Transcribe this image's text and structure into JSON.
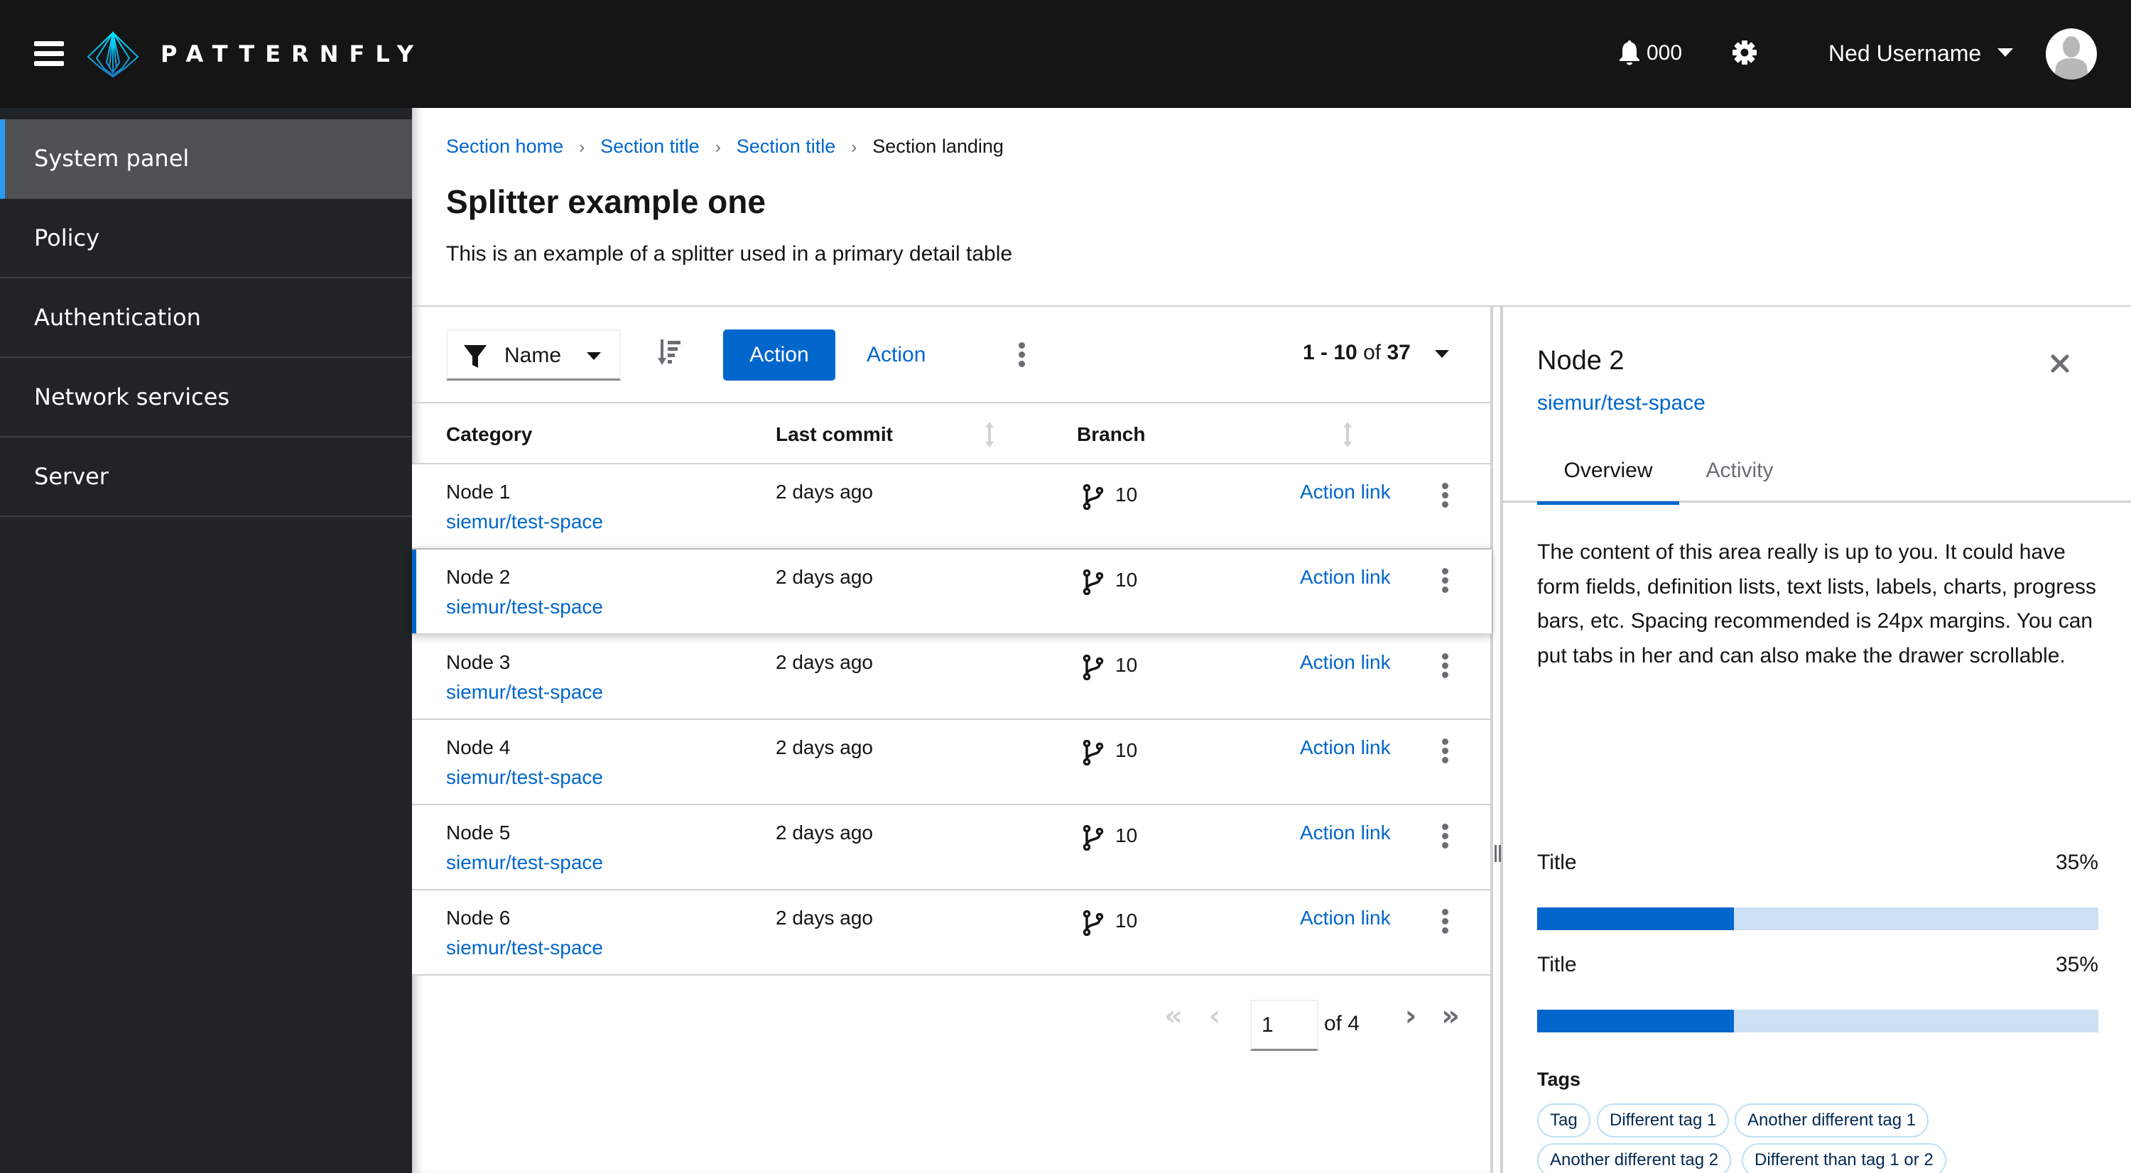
{
  "masthead": {
    "brand": "PATTERNFLY",
    "notification_count": "000",
    "user_name": "Ned Username",
    "icons": {
      "menu": "hamburger-icon",
      "logo": "patternfly-logo-icon",
      "notifications": "bell-icon",
      "settings": "gear-icon",
      "user_menu": "caret-down-icon",
      "avatar": "user-avatar-icon"
    }
  },
  "sidebar": {
    "items": [
      {
        "label": "System panel",
        "active": true
      },
      {
        "label": "Policy",
        "active": false
      },
      {
        "label": "Authentication",
        "active": false
      },
      {
        "label": "Network services",
        "active": false
      },
      {
        "label": "Server",
        "active": false
      }
    ]
  },
  "breadcrumb": {
    "items": [
      "Section home",
      "Section title",
      "Section title"
    ],
    "current": "Section landing",
    "separator_icon": "angle-right-icon"
  },
  "page": {
    "title": "Splitter example one",
    "description": "This is an example of a splitter used in a primary detail table"
  },
  "toolbar": {
    "filter_label": "Name",
    "filter_icon": "filter-icon",
    "sort_icon": "sort-amount-down-icon",
    "primary_action": "Action",
    "link_action": "Action",
    "overflow_icon": "kebab-icon",
    "pagination": {
      "range": "1 - 10",
      "of_label": "of",
      "total": "37"
    }
  },
  "table": {
    "columns": [
      {
        "label": "Category",
        "sortable": true
      },
      {
        "label": "Last commit",
        "sortable": true
      },
      {
        "label": "Branch",
        "sortable": false
      }
    ],
    "rows": [
      {
        "name": "Node 1",
        "repo": "siemur/test-space",
        "commit": "2 days ago",
        "branches": "10",
        "action": "Action link",
        "selected": false
      },
      {
        "name": "Node 2",
        "repo": "siemur/test-space",
        "commit": "2 days ago",
        "branches": "10",
        "action": "Action link",
        "selected": true
      },
      {
        "name": "Node 3",
        "repo": "siemur/test-space",
        "commit": "2 days ago",
        "branches": "10",
        "action": "Action link",
        "selected": false
      },
      {
        "name": "Node 4",
        "repo": "siemur/test-space",
        "commit": "2 days ago",
        "branches": "10",
        "action": "Action link",
        "selected": false
      },
      {
        "name": "Node 5",
        "repo": "siemur/test-space",
        "commit": "2 days ago",
        "branches": "10",
        "action": "Action link",
        "selected": false
      },
      {
        "name": "Node 6",
        "repo": "siemur/test-space",
        "commit": "2 days ago",
        "branches": "10",
        "action": "Action link",
        "selected": false
      }
    ]
  },
  "pagination": {
    "current_page": "1",
    "of_label": "of 4",
    "first_enabled": false,
    "prev_enabled": false,
    "next_enabled": true,
    "last_enabled": true,
    "icons": {
      "first": "«",
      "prev": "‹",
      "next": "›",
      "last": "»"
    }
  },
  "drawer": {
    "title": "Node 2",
    "link": "siemur/test-space",
    "close_icon": "times-icon",
    "tabs": [
      {
        "label": "Overview",
        "active": true
      },
      {
        "label": "Activity",
        "active": false
      }
    ],
    "body": "The content of this area really is up to you. It could have form fields, definition lists, text lists, labels, charts, progress bars, etc. Spacing recommended is 24px margins. You can put tabs in her and can also make the drawer scrollable.",
    "progress": [
      {
        "title": "Title",
        "value_label": "35%",
        "value": 35
      },
      {
        "title": "Title",
        "value_label": "35%",
        "value": 35
      }
    ],
    "tags_title": "Tags",
    "tags": [
      "Tag",
      "Different tag 1",
      "Another different tag 1",
      "Another different tag 2",
      "Different than tag 1 or 2"
    ]
  },
  "colors": {
    "brand_blue": "#0066cc",
    "nav_active_accent": "#2b9af3",
    "masthead_bg": "#151515",
    "sidebar_bg": "#212427",
    "progress_track": "#cce1f5",
    "tag_border": "#bee1f4"
  }
}
